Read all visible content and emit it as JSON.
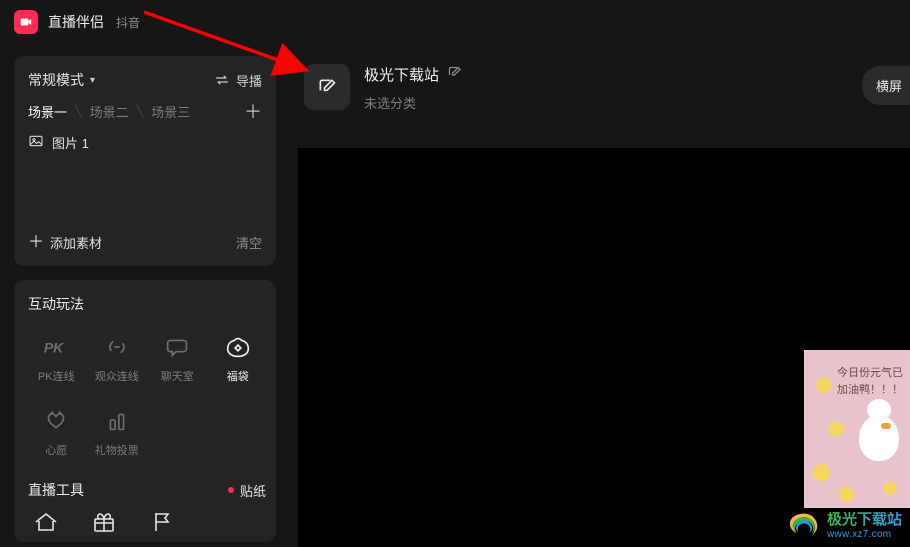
{
  "app": {
    "title": "直播伴侣",
    "subtitle": "抖音"
  },
  "scene_panel": {
    "mode_label": "常规模式",
    "switch_label": "导播",
    "tabs": [
      "场景一",
      "场景二",
      "场景三"
    ],
    "active_tab": 0,
    "source_item": "图片 1",
    "add_source": "添加素材",
    "clear": "清空"
  },
  "interact": {
    "title": "互动玩法",
    "items": [
      {
        "label": "PK连线"
      },
      {
        "label": "观众连线"
      },
      {
        "label": "聊天室"
      },
      {
        "label": "福袋"
      },
      {
        "label": "心愿"
      },
      {
        "label": "礼物投票"
      }
    ],
    "active_index": 3
  },
  "tools": {
    "title": "直播工具",
    "sticker": "贴纸"
  },
  "room": {
    "title": "极光下载站",
    "category": "未选分类",
    "orientation": "横屏"
  },
  "sticker_text": "今日份元气已\n加油鸭！！！",
  "watermark": {
    "line1": "极光下载站",
    "line2": "www.xz7.com"
  }
}
